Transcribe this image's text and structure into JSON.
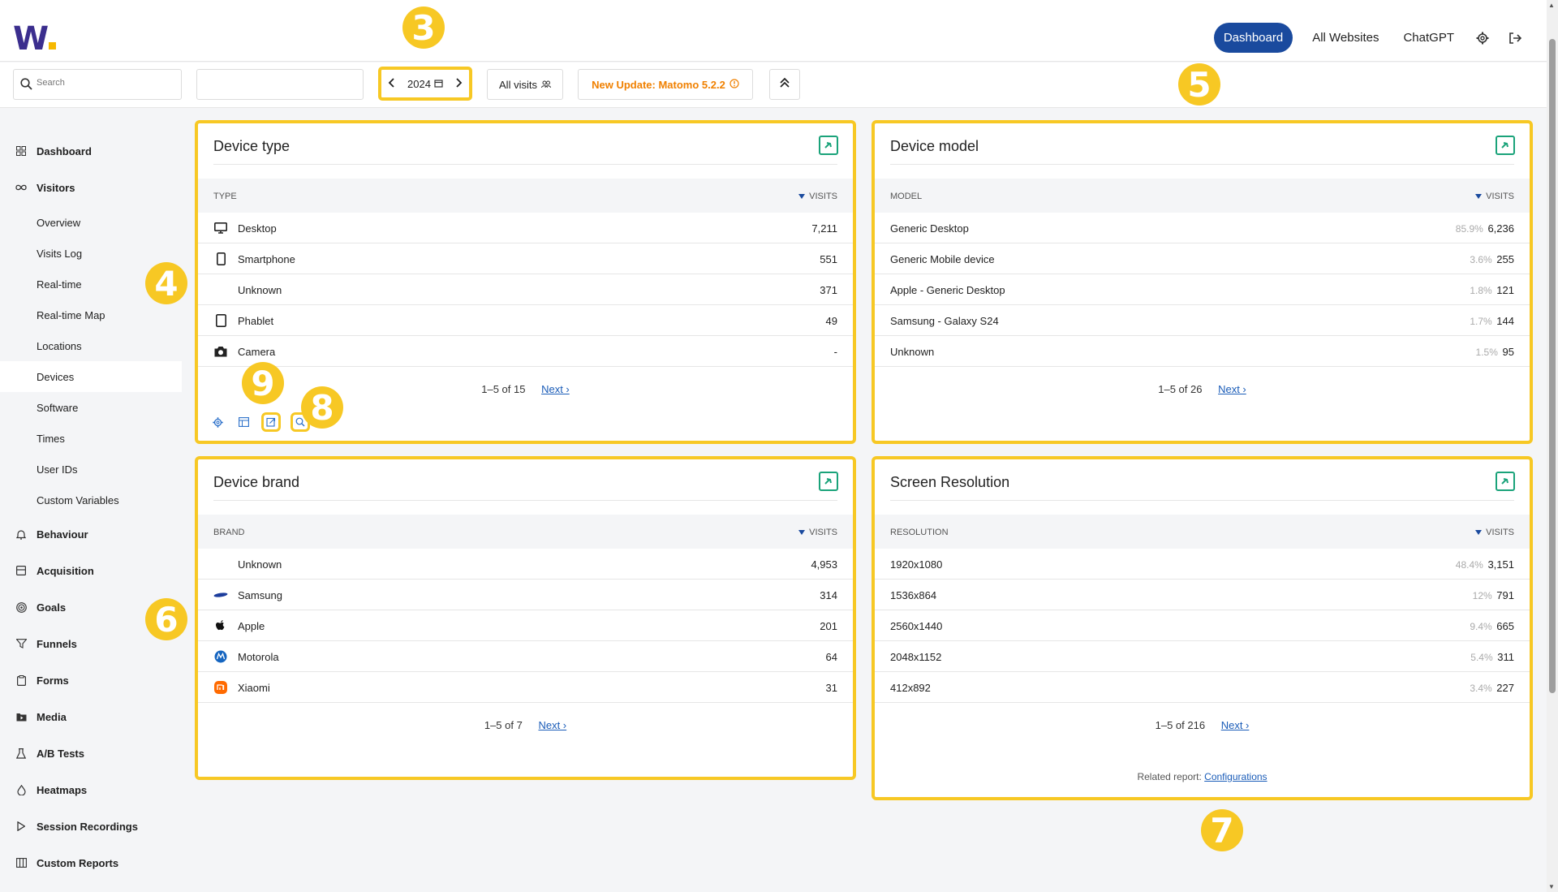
{
  "app": {
    "logo_text": "W"
  },
  "topnav": {
    "dashboard": "Dashboard",
    "all_websites": "All Websites",
    "chatgpt": "ChatGPT",
    "settings_icon": "gear-icon",
    "logout_icon": "logout-icon"
  },
  "filters": {
    "search_placeholder": "Search",
    "period": "2024",
    "segment": "All visits",
    "update": "New Update: Matomo 5.2.2"
  },
  "sidebar": {
    "items": [
      {
        "label": "Dashboard",
        "icon": "grid-icon",
        "main": true
      },
      {
        "label": "Visitors",
        "icon": "infinity-icon",
        "main": true
      },
      {
        "label": "Overview"
      },
      {
        "label": "Visits Log"
      },
      {
        "label": "Real-time"
      },
      {
        "label": "Real-time Map"
      },
      {
        "label": "Locations"
      },
      {
        "label": "Devices",
        "active": true
      },
      {
        "label": "Software"
      },
      {
        "label": "Times"
      },
      {
        "label": "User IDs"
      },
      {
        "label": "Custom Variables"
      },
      {
        "label": "Behaviour",
        "icon": "bell-icon",
        "main": true
      },
      {
        "label": "Acquisition",
        "icon": "inbox-icon",
        "main": true
      },
      {
        "label": "Goals",
        "icon": "target-icon",
        "main": true
      },
      {
        "label": "Funnels",
        "icon": "funnel-icon",
        "main": true
      },
      {
        "label": "Forms",
        "icon": "clipboard-icon",
        "main": true
      },
      {
        "label": "Media",
        "icon": "media-icon",
        "main": true
      },
      {
        "label": "A/B Tests",
        "icon": "flask-icon",
        "main": true
      },
      {
        "label": "Heatmaps",
        "icon": "drop-icon",
        "main": true
      },
      {
        "label": "Session Recordings",
        "icon": "play-icon",
        "main": true
      },
      {
        "label": "Custom Reports",
        "icon": "columns-icon",
        "main": true
      }
    ]
  },
  "cards": {
    "device_type": {
      "title": "Device type",
      "col1": "TYPE",
      "col2": "VISITS",
      "rows": [
        {
          "label": "Desktop",
          "value": "7,211"
        },
        {
          "label": "Smartphone",
          "value": "551"
        },
        {
          "label": "Unknown",
          "value": "371"
        },
        {
          "label": "Phablet",
          "value": "49"
        },
        {
          "label": "Camera",
          "value": "-"
        }
      ],
      "pager": "1–5 of 15",
      "next": "Next ›"
    },
    "device_model": {
      "title": "Device model",
      "col1": "MODEL",
      "col2": "VISITS",
      "rows": [
        {
          "label": "Generic Desktop",
          "pct": "85.9%",
          "value": "6,236"
        },
        {
          "label": "Generic Mobile device",
          "pct": "3.6%",
          "value": "255"
        },
        {
          "label": "Apple - Generic Desktop",
          "pct": "1.8%",
          "value": "121"
        },
        {
          "label": "Samsung - Galaxy S24",
          "pct": "1.7%",
          "value": "144"
        },
        {
          "label": "Unknown",
          "pct": "1.5%",
          "value": "95"
        }
      ],
      "pager": "1–5 of 26",
      "next": "Next ›"
    },
    "device_brand": {
      "title": "Device brand",
      "col1": "BRAND",
      "col2": "VISITS",
      "rows": [
        {
          "label": "Unknown",
          "value": "4,953"
        },
        {
          "label": "Samsung",
          "value": "314"
        },
        {
          "label": "Apple",
          "value": "201"
        },
        {
          "label": "Motorola",
          "value": "64"
        },
        {
          "label": "Xiaomi",
          "value": "31"
        }
      ],
      "pager": "1–5 of 7",
      "next": "Next ›"
    },
    "screen_resolution": {
      "title": "Screen Resolution",
      "col1": "RESOLUTION",
      "col2": "VISITS",
      "rows": [
        {
          "label": "1920x1080",
          "pct": "48.4%",
          "value": "3,151"
        },
        {
          "label": "1536x864",
          "pct": "12%",
          "value": "791"
        },
        {
          "label": "2560x1440",
          "pct": "9.4%",
          "value": "665"
        },
        {
          "label": "2048x1152",
          "pct": "5.4%",
          "value": "311"
        },
        {
          "label": "412x892",
          "pct": "3.4%",
          "value": "227"
        }
      ],
      "pager": "1–5 of 216",
      "next": "Next ›",
      "related_label": "Related report:",
      "related_link": "Configurations"
    }
  },
  "badges": {
    "b3": "3",
    "b4": "4",
    "b5": "5",
    "b6": "6",
    "b7": "7",
    "b8": "8",
    "b9": "9"
  },
  "colors": {
    "accent": "#1a4a9e",
    "highlight": "#f7c824",
    "update": "#f08000",
    "link": "#1a5cb8"
  }
}
